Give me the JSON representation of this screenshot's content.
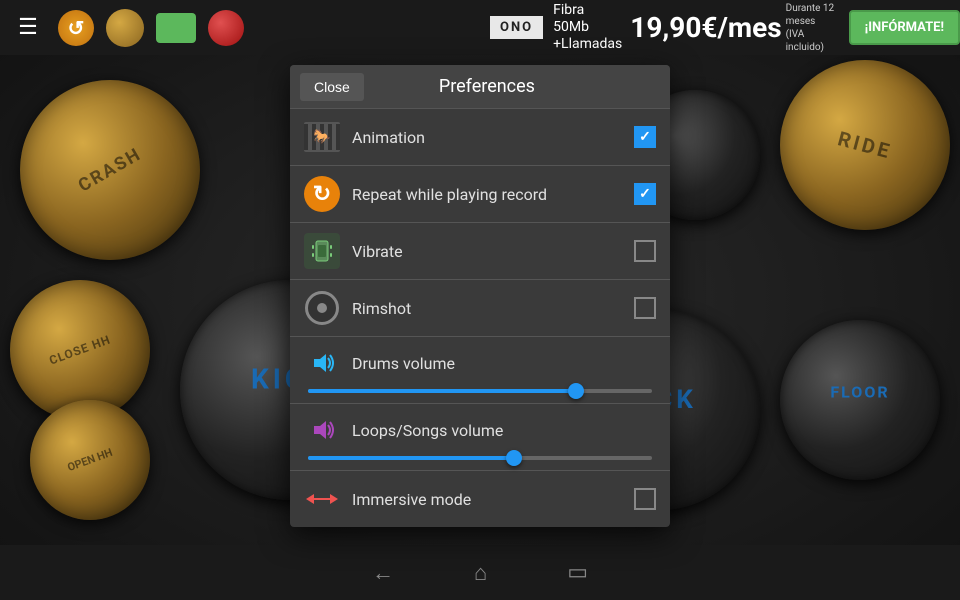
{
  "toolbar": {
    "menu_label": "☰",
    "sync_label": "↺",
    "metronome_label": "",
    "green_label": "",
    "record_label": ""
  },
  "ad": {
    "logo": "ONO",
    "line1": "Fibra 50Mb",
    "line2": "+Llamadas",
    "price": "19,90€/mes",
    "footnote1": "Durante 12 meses",
    "footnote2": "(IVA incluido)",
    "cta": "¡INFÓRMATE!"
  },
  "preferences": {
    "title": "Preferences",
    "close_label": "Close",
    "items": [
      {
        "label": "Animation",
        "icon_type": "film",
        "checked": true
      },
      {
        "label": "Repeat while playing record",
        "icon_type": "repeat",
        "checked": true
      },
      {
        "label": "Vibrate",
        "icon_type": "vibrate",
        "checked": false
      },
      {
        "label": "Rimshot",
        "icon_type": "rimshot",
        "checked": false
      }
    ],
    "sliders": [
      {
        "label": "Drums volume",
        "icon_type": "volume-drums",
        "fill_percent": 78
      },
      {
        "label": "Loops/Songs volume",
        "icon_type": "volume-loops",
        "fill_percent": 60
      }
    ],
    "extra_items": [
      {
        "label": "Immersive mode",
        "icon_type": "immersive",
        "checked": false
      }
    ]
  },
  "bottom_nav": {
    "back_label": "←",
    "home_label": "⌂",
    "recent_label": "▭"
  },
  "drums": {
    "kick_label": "KICK",
    "crash_label": "CRASH",
    "ride_label": "RIDE",
    "close_hh_label": "CLOSE HH",
    "open_hh_label": "OPEN HH",
    "floor_label": "FLOOR"
  }
}
